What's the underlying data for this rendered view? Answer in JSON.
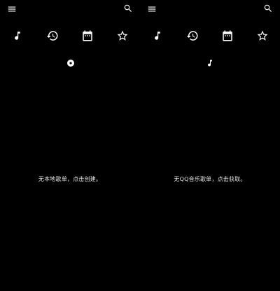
{
  "colors": {
    "background": "#000000",
    "icon": "#ffffff",
    "text": "#e6e6e6"
  },
  "screens": [
    {
      "header": {
        "left_icon": "menu-icon",
        "right_icon": "search-icon"
      },
      "tabs": [
        {
          "icon": "music-note-icon"
        },
        {
          "icon": "history-icon"
        },
        {
          "icon": "calendar-icon"
        },
        {
          "icon": "star-icon"
        }
      ],
      "active_tab_index": 0,
      "indicator_icon": "record-icon",
      "empty_message": "无本地歌单，点击创建。"
    },
    {
      "header": {
        "left_icon": "menu-icon",
        "right_icon": "search-icon"
      },
      "tabs": [
        {
          "icon": "music-note-icon"
        },
        {
          "icon": "history-icon"
        },
        {
          "icon": "calendar-icon"
        },
        {
          "icon": "star-icon"
        }
      ],
      "active_tab_index": 0,
      "indicator_icon": "music-note-icon",
      "empty_message": "无QQ音乐歌单，点击获取。"
    }
  ]
}
